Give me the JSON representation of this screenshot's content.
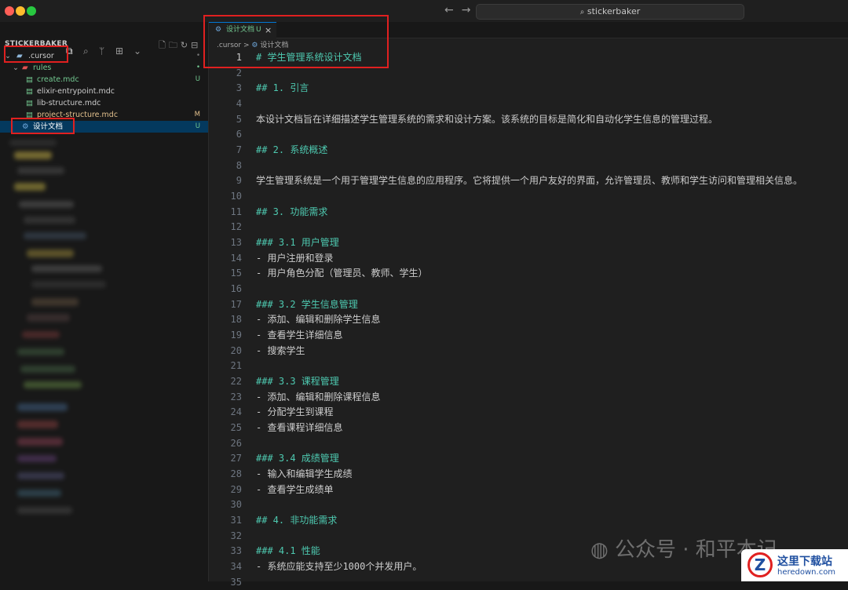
{
  "window": {
    "search_text": "stickerbaker"
  },
  "sidebar": {
    "header": "STICKERBAKER",
    "tree": [
      {
        "label": ".cursor",
        "badge": "•",
        "indent": 1
      },
      {
        "label": "rules",
        "badge": "•",
        "indent": 2
      },
      {
        "label": "create.mdc",
        "badge": "U",
        "indent": 3
      },
      {
        "label": "elixir-entrypoint.mdc",
        "badge": "",
        "indent": 3
      },
      {
        "label": "lib-structure.mdc",
        "badge": "",
        "indent": 3
      },
      {
        "label": "project-structure.mdc",
        "badge": "M",
        "indent": 3
      },
      {
        "label": "设计文档",
        "badge": "U",
        "indent": 2
      }
    ]
  },
  "editor": {
    "tab": {
      "label": "设计文档",
      "status": "U",
      "close": "×"
    },
    "breadcrumb": {
      "folder": ".cursor",
      "separator": ">",
      "file": "设计文档"
    },
    "lines": [
      {
        "n": "1",
        "text": "# 学生管理系统设计文档",
        "heading": true
      },
      {
        "n": "2",
        "text": ""
      },
      {
        "n": "3",
        "text": "## 1. 引言",
        "heading": true
      },
      {
        "n": "4",
        "text": ""
      },
      {
        "n": "5",
        "text": "本设计文档旨在详细描述学生管理系统的需求和设计方案。该系统的目标是简化和自动化学生信息的管理过程。"
      },
      {
        "n": "6",
        "text": ""
      },
      {
        "n": "7",
        "text": "## 2. 系统概述",
        "heading": true
      },
      {
        "n": "8",
        "text": ""
      },
      {
        "n": "9",
        "text": "学生管理系统是一个用于管理学生信息的应用程序。它将提供一个用户友好的界面，允许管理员、教师和学生访问和管理相关信息。"
      },
      {
        "n": "10",
        "text": ""
      },
      {
        "n": "11",
        "text": "## 3. 功能需求",
        "heading": true
      },
      {
        "n": "12",
        "text": ""
      },
      {
        "n": "13",
        "text": "### 3.1 用户管理",
        "heading": true
      },
      {
        "n": "14",
        "text": "- 用户注册和登录"
      },
      {
        "n": "15",
        "text": "- 用户角色分配（管理员、教师、学生）"
      },
      {
        "n": "16",
        "text": ""
      },
      {
        "n": "17",
        "text": "### 3.2 学生信息管理",
        "heading": true
      },
      {
        "n": "18",
        "text": "- 添加、编辑和删除学生信息"
      },
      {
        "n": "19",
        "text": "- 查看学生详细信息"
      },
      {
        "n": "20",
        "text": "- 搜索学生"
      },
      {
        "n": "21",
        "text": ""
      },
      {
        "n": "22",
        "text": "### 3.3 课程管理",
        "heading": true
      },
      {
        "n": "23",
        "text": "- 添加、编辑和删除课程信息"
      },
      {
        "n": "24",
        "text": "- 分配学生到课程"
      },
      {
        "n": "25",
        "text": "- 查看课程详细信息"
      },
      {
        "n": "26",
        "text": ""
      },
      {
        "n": "27",
        "text": "### 3.4 成绩管理",
        "heading": true
      },
      {
        "n": "28",
        "text": "- 输入和编辑学生成绩"
      },
      {
        "n": "29",
        "text": "- 查看学生成绩单"
      },
      {
        "n": "30",
        "text": ""
      },
      {
        "n": "31",
        "text": "## 4. 非功能需求",
        "heading": true
      },
      {
        "n": "32",
        "text": ""
      },
      {
        "n": "33",
        "text": "### 4.1 性能",
        "heading": true
      },
      {
        "n": "34",
        "text": "- 系统应能支持至少1000个并发用户。"
      },
      {
        "n": "35",
        "text": ""
      }
    ]
  },
  "watermark": {
    "text": "公众号 · 和平本记",
    "site_name": "这里下载站",
    "site_url": "heredown.com"
  },
  "colors": {
    "heading": "#4ec9b0",
    "untracked": "#73c991",
    "modified": "#e2c08d",
    "highlight_box": "#e02020",
    "selection": "#04395e"
  }
}
